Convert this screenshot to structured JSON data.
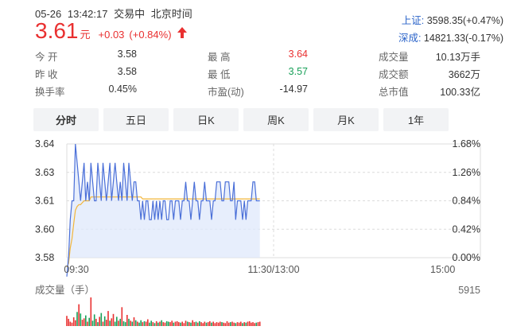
{
  "header": {
    "date": "05-26",
    "time": "13:42:17",
    "status": "交易中",
    "timezone": "北京时间",
    "price": "3.61",
    "price_unit": "元",
    "change": "+0.03",
    "change_pct": "(+0.84%)"
  },
  "indices": [
    {
      "name": "上证:",
      "value": "3598.35(+0.47%)"
    },
    {
      "name": "深成:",
      "value": "14821.33(-0.17%)"
    }
  ],
  "quotes": [
    {
      "label": "今  开",
      "value": "3.58",
      "color": "dark"
    },
    {
      "label": "最  高",
      "value": "3.64",
      "color": "red"
    },
    {
      "label": "成交量",
      "value": "10.13万手",
      "color": "dark"
    },
    {
      "label": "昨  收",
      "value": "3.58",
      "color": "dark"
    },
    {
      "label": "最  低",
      "value": "3.57",
      "color": "green"
    },
    {
      "label": "成交额",
      "value": "3662万",
      "color": "dark"
    },
    {
      "label": "换手率",
      "value": "0.45%",
      "color": "dark"
    },
    {
      "label": "市盈(动)",
      "value": "-14.97",
      "color": "dark"
    },
    {
      "label": "总市值",
      "value": "100.33亿",
      "color": "dark"
    }
  ],
  "tabs": [
    "分时",
    "五日",
    "日K",
    "周K",
    "月K",
    "1年"
  ],
  "active_tab": 0,
  "colors": {
    "up": "#e93030",
    "down": "#18a058",
    "price_line": "#4a6fd8",
    "avg_line": "#f2b53a",
    "area_fill": "#dfe8fb",
    "grid": "#dcdcdc"
  },
  "chart_data": {
    "type": "line",
    "title": "",
    "y_ticks": [
      "3.64",
      "3.63",
      "3.61",
      "3.60",
      "3.58"
    ],
    "pct_ticks": [
      "1.68%",
      "1.26%",
      "0.84%",
      "0.42%",
      "0.00%"
    ],
    "x_ticks": [
      "09:30",
      "11:30/13:00",
      "15:00"
    ],
    "ylim": [
      3.58,
      3.64
    ],
    "prev_close": 3.58,
    "total_minutes": 240,
    "series": [
      {
        "name": "",
        "role": "price",
        "values": [
          3.57,
          3.58,
          3.6,
          3.61,
          3.61,
          3.64,
          3.63,
          3.62,
          3.61,
          3.62,
          3.63,
          3.61,
          3.62,
          3.61,
          3.63,
          3.62,
          3.61,
          3.61,
          3.63,
          3.62,
          3.61,
          3.63,
          3.62,
          3.61,
          3.62,
          3.63,
          3.61,
          3.62,
          3.63,
          3.62,
          3.61,
          3.62,
          3.61,
          3.63,
          3.62,
          3.61,
          3.63,
          3.62,
          3.61,
          3.62,
          3.62,
          3.61,
          3.61,
          3.6,
          3.61,
          3.6,
          3.61,
          3.61,
          3.6,
          3.6,
          3.61,
          3.6,
          3.61,
          3.6,
          3.61,
          3.6,
          3.61,
          3.61,
          3.6,
          3.6,
          3.61,
          3.61,
          3.6,
          3.61,
          3.61,
          3.61,
          3.6,
          3.61,
          3.61,
          3.62,
          3.61,
          3.61,
          3.6,
          3.61,
          3.62,
          3.61,
          3.61,
          3.6,
          3.61,
          3.61,
          3.62,
          3.61,
          3.61,
          3.61,
          3.6,
          3.61,
          3.61,
          3.62,
          3.62,
          3.62,
          3.61,
          3.61,
          3.62,
          3.62,
          3.62,
          3.61,
          3.61,
          3.62,
          3.6,
          3.61,
          3.61,
          3.61,
          3.6,
          3.61,
          3.6,
          3.61,
          3.61,
          3.61,
          3.62,
          3.62,
          3.61,
          3.61,
          3.61
        ]
      },
      {
        "name": "",
        "role": "average",
        "values": [
          3.575,
          3.577,
          3.585,
          3.59,
          3.598,
          3.605,
          3.607,
          3.608,
          3.608,
          3.609,
          3.61,
          3.61,
          3.61,
          3.61,
          3.612,
          3.612,
          3.612,
          3.612,
          3.612,
          3.612,
          3.612,
          3.612,
          3.612,
          3.612,
          3.612,
          3.612,
          3.612,
          3.612,
          3.612,
          3.612,
          3.612,
          3.612,
          3.612,
          3.612,
          3.612,
          3.612,
          3.612,
          3.612,
          3.612,
          3.612,
          3.612,
          3.612,
          3.612,
          3.612,
          3.611,
          3.611,
          3.611,
          3.611,
          3.611,
          3.611,
          3.611,
          3.611,
          3.611,
          3.611,
          3.611,
          3.611,
          3.611,
          3.611,
          3.611,
          3.611,
          3.611,
          3.611,
          3.611,
          3.611,
          3.611,
          3.611,
          3.611,
          3.611,
          3.611,
          3.611,
          3.611,
          3.611,
          3.611,
          3.611,
          3.611,
          3.611,
          3.611,
          3.611,
          3.611,
          3.611,
          3.611,
          3.611,
          3.611,
          3.611,
          3.611,
          3.611,
          3.611,
          3.611,
          3.611,
          3.611,
          3.611,
          3.611,
          3.611,
          3.611,
          3.611,
          3.611,
          3.611,
          3.611,
          3.611,
          3.611,
          3.611,
          3.611,
          3.611,
          3.611,
          3.611,
          3.611,
          3.611,
          3.611,
          3.611,
          3.611,
          3.611,
          3.611,
          3.611
        ]
      }
    ],
    "volume": {
      "label": "成交量（手）",
      "max_label": "5915",
      "max": 5915,
      "values": [
        2100,
        1500,
        900,
        700,
        1800,
        1200,
        2900,
        4500,
        2600,
        1300,
        1600,
        2200,
        900,
        1700,
        5915,
        1100,
        2400,
        1500,
        800,
        1900,
        2700,
        900,
        2000,
        1300,
        3100,
        1100,
        1600,
        2500,
        900,
        1900,
        1100,
        1500,
        3900,
        1000,
        800,
        2300,
        1500,
        1100,
        900,
        1800,
        1200,
        900,
        700,
        1200,
        800,
        1000,
        900,
        1400,
        700,
        1100,
        800,
        600,
        1000,
        700,
        900,
        1200,
        800,
        700,
        1000,
        900,
        800,
        1100,
        700,
        900,
        1000,
        800,
        700,
        900,
        600,
        1100,
        900,
        800,
        700,
        1200,
        800,
        900,
        700,
        1000,
        800,
        600,
        900,
        700,
        800,
        1000,
        700,
        900,
        600,
        800,
        700,
        900,
        800,
        700,
        600,
        1000,
        700,
        800,
        900,
        700,
        600,
        800,
        700,
        900,
        600,
        800,
        700,
        900,
        1000,
        700,
        800,
        600,
        700,
        800,
        900
      ],
      "dirs": [
        "u",
        "u",
        "u",
        "u",
        "u",
        "u",
        "d",
        "u",
        "d",
        "u",
        "u",
        "d",
        "u",
        "d",
        "u",
        "d",
        "d",
        "u",
        "d",
        "u",
        "d",
        "u",
        "d",
        "u",
        "u",
        "d",
        "u",
        "u",
        "d",
        "d",
        "u",
        "d",
        "u",
        "d",
        "d",
        "u",
        "d",
        "u",
        "d",
        "u",
        "d",
        "u",
        "d",
        "d",
        "u",
        "d",
        "u",
        "u",
        "d",
        "d",
        "u",
        "d",
        "u",
        "d",
        "u",
        "d",
        "u",
        "u",
        "d",
        "d",
        "u",
        "u",
        "d",
        "u",
        "u",
        "u",
        "d",
        "u",
        "u",
        "u",
        "d",
        "u",
        "d",
        "u",
        "u",
        "d",
        "u",
        "d",
        "u",
        "u",
        "u",
        "d",
        "u",
        "u",
        "d",
        "u",
        "u",
        "u",
        "u",
        "u",
        "d",
        "u",
        "u",
        "u",
        "u",
        "d",
        "u",
        "u",
        "d",
        "u",
        "u",
        "u",
        "d",
        "u",
        "d",
        "u",
        "u",
        "u",
        "u",
        "u",
        "d",
        "u",
        "u"
      ]
    }
  }
}
